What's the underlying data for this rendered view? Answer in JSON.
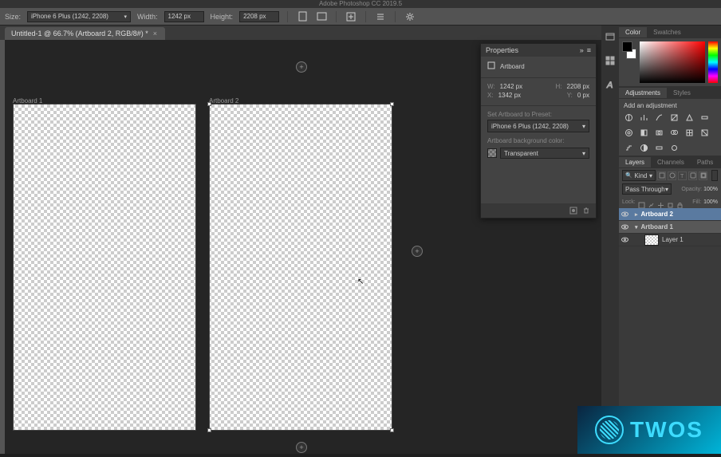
{
  "app_title": "Adobe Photoshop CC 2019.5",
  "options_bar": {
    "size_label": "Size:",
    "size_value": "iPhone 6 Plus (1242, 2208)",
    "width_label": "Width:",
    "width_value": "1242 px",
    "height_label": "Height:",
    "height_value": "2208 px"
  },
  "document_tab": {
    "title": "Untitled-1 @ 66.7% (Artboard 2, RGB/8#) *"
  },
  "artboards": [
    {
      "label": "Artboard 1"
    },
    {
      "label": "Artboard 2"
    }
  ],
  "properties_panel": {
    "title": "Properties",
    "type_label": "Artboard",
    "w_label": "W:",
    "w_value": "1242 px",
    "h_label": "H:",
    "h_value": "2208 px",
    "x_label": "X:",
    "x_value": "1342 px",
    "y_label": "Y:",
    "y_value": "0 px",
    "preset_label": "Set Artboard to Preset:",
    "preset_value": "iPhone 6 Plus (1242, 2208)",
    "bg_label": "Artboard background color:",
    "bg_value": "Transparent"
  },
  "right_tabs": {
    "color": "Color",
    "swatches": "Swatches",
    "adjustments": "Adjustments",
    "styles": "Styles",
    "layers": "Layers",
    "channels": "Channels",
    "paths": "Paths"
  },
  "adjustments": {
    "title": "Add an adjustment"
  },
  "layers_panel": {
    "filter_kind": "Kind",
    "blend_mode": "Pass Through",
    "opacity_label": "Opacity:",
    "opacity_value": "100%",
    "lock_label": "Lock:",
    "fill_label": "Fill:",
    "fill_value": "100%",
    "layers": [
      {
        "name": "Artboard 2",
        "type": "artboard",
        "selected": true
      },
      {
        "name": "Artboard 1",
        "type": "artboard",
        "selected": false
      },
      {
        "name": "Layer 1",
        "type": "layer",
        "selected": false
      }
    ]
  },
  "watermark": {
    "text": "TWOS"
  }
}
